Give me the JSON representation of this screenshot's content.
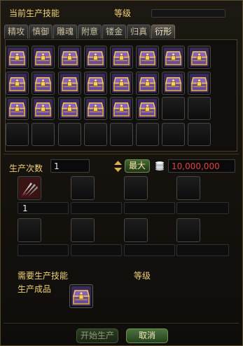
{
  "header": {
    "current_skill_label": "当前生产技能",
    "level_label": "等级"
  },
  "tabs": [
    "精攻",
    "慎御",
    "雕魂",
    "附意",
    "镂金",
    "归真",
    "衍形"
  ],
  "active_tab": 6,
  "recipe_grid": {
    "filled_count": 22,
    "item_icon": "golden-treasure-chest-icon"
  },
  "production": {
    "count_label": "生产次数",
    "count_value": "1",
    "max_label": "最大",
    "cost_icon": "silver-coins-icon",
    "cost_value": "10,000,000",
    "cost_color": "#e04040"
  },
  "materials": {
    "first_icon": "claw-blade-material-icon",
    "first_count": "1"
  },
  "requirements": {
    "need_skill_label": "需要生产技能",
    "level_label": "等级",
    "result_label": "生产成品"
  },
  "buttons": {
    "start_label": "开始生产",
    "cancel_label": "取消"
  }
}
